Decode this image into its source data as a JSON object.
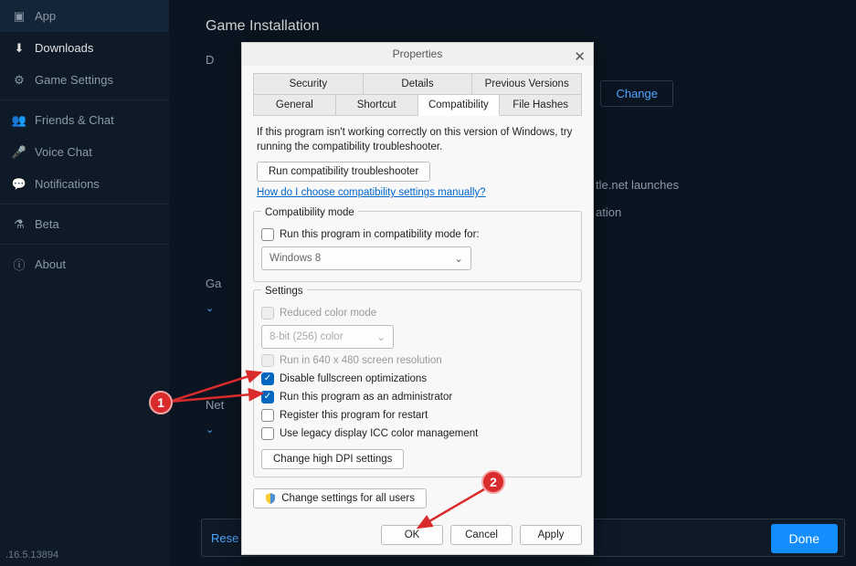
{
  "sidebar": {
    "items": [
      {
        "label": "App",
        "icon": "app"
      },
      {
        "label": "Downloads",
        "icon": "download"
      },
      {
        "label": "Game Settings",
        "icon": "settings"
      },
      {
        "label": "Friends & Chat",
        "icon": "friends"
      },
      {
        "label": "Voice Chat",
        "icon": "mic"
      },
      {
        "label": "Notifications",
        "icon": "bell"
      },
      {
        "label": "Beta",
        "icon": "beta"
      },
      {
        "label": "About",
        "icon": "info"
      }
    ]
  },
  "main": {
    "section_title": "Game Installation",
    "label_d": "D",
    "change_btn": "Change",
    "section_game": "Ga",
    "section_net": "Net",
    "fragment1": "tle.net launches",
    "fragment2": "ation",
    "reset_btn": "Rese",
    "done_btn": "Done",
    "version": ".16.5.13894"
  },
  "dialog": {
    "title": "Properties",
    "tabs_row1": [
      "Security",
      "Details",
      "Previous Versions"
    ],
    "tabs_row2": [
      "General",
      "Shortcut",
      "Compatibility",
      "File Hashes"
    ],
    "active_tab": "Compatibility",
    "info_text": "If this program isn't working correctly on this version of Windows, try running the compatibility troubleshooter.",
    "run_troubleshooter_btn": "Run compatibility troubleshooter",
    "help_link": "How do I choose compatibility settings manually?",
    "compat_mode": {
      "legend": "Compatibility mode",
      "checkbox_label": "Run this program in compatibility mode for:",
      "select_value": "Windows 8"
    },
    "settings": {
      "legend": "Settings",
      "reduced_color": "Reduced color mode",
      "color_select": "8-bit (256) color",
      "run_640": "Run in 640 x 480 screen resolution",
      "disable_fullscreen": "Disable fullscreen optimizations",
      "run_admin": "Run this program as an administrator",
      "register_restart": "Register this program for restart",
      "use_legacy_icc": "Use legacy display ICC color management",
      "dpi_btn": "Change high DPI settings"
    },
    "change_all_users_btn": "Change settings for all users",
    "buttons": {
      "ok": "OK",
      "cancel": "Cancel",
      "apply": "Apply"
    }
  },
  "callouts": {
    "one": "1",
    "two": "2"
  }
}
